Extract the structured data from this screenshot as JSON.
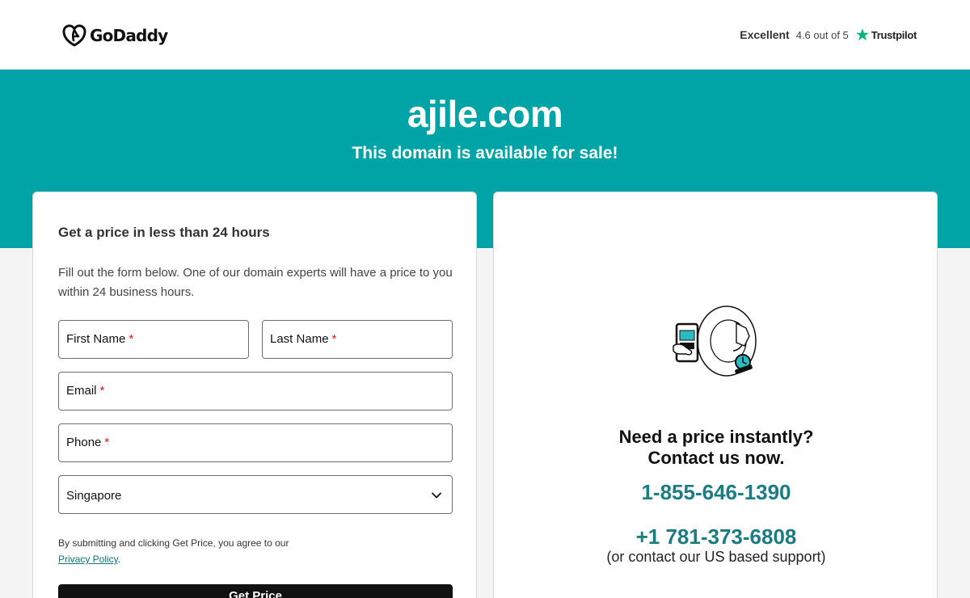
{
  "header": {
    "brand": "GoDaddy",
    "trustpilot": {
      "rating_word": "Excellent",
      "score": "4.6 out of 5",
      "brand": "Trustpilot",
      "star_color": "#00b67a"
    }
  },
  "hero": {
    "domain": "ajile.com",
    "subtitle": "This domain is available for sale!",
    "bg_color": "#00a4a6"
  },
  "form": {
    "title": "Get a price in less than 24 hours",
    "description": "Fill out the form below. One of our domain experts will have a price to you within 24 business hours.",
    "first_name_label": "First Name",
    "last_name_label": "Last Name",
    "email_label": "Email",
    "phone_label": "Phone",
    "required_mark": "*",
    "country_value": "Singapore",
    "legal_text": "By submitting and clicking Get Price, you agree to our",
    "privacy_link": "Privacy Policy",
    "legal_end": ".",
    "submit_label": "Get Price"
  },
  "contact": {
    "illustration_icon": "phone-hand-clock-illustration",
    "cta_line1": "Need a price instantly?",
    "cta_line2": "Contact us now.",
    "phone_1": "1-855-646-1390",
    "phone_2": "+1 781-373-6808",
    "support_note": "(or contact our US based support)",
    "accent_color": "#1b7d83"
  }
}
